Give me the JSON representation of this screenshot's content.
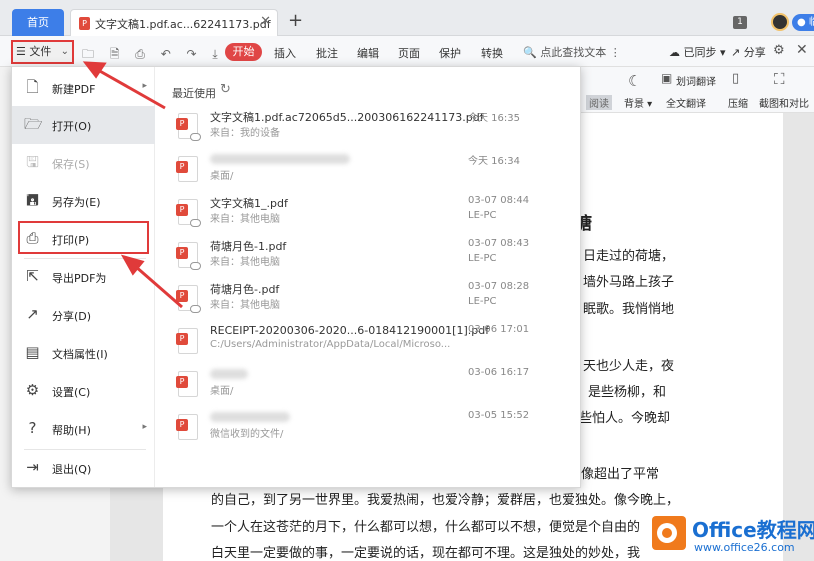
{
  "tabs": {
    "home": "首页",
    "doc_title": "文字文稿1.pdf.ac...62241173.pdf",
    "close": "✕",
    "add": "+"
  },
  "header_right": {
    "badge": "1",
    "pill": "● 临"
  },
  "toolbar": {
    "file_label": "☰ 文件",
    "chevron": "⌄",
    "icons": "🗀 🗎 ⎙ ↶ ↷ ⤓ ▿",
    "start": "开始",
    "items": [
      "插入",
      "批注",
      "编辑",
      "页面",
      "保护",
      "转换"
    ],
    "search": "🔍 点此查找文本 ⋮",
    "sync": "☁ 已同步 ▾",
    "share": "↗ 分享",
    "gear": "⚙",
    "close": "✕"
  },
  "ribbon": {
    "translate": "划词翻译",
    "background": "背景 ▾",
    "full_translate": "全文翻译",
    "compress": "压缩",
    "screenshot": "截图和对比",
    "read_tag": "阅读"
  },
  "menu": {
    "items": [
      {
        "label": "新建PDF",
        "icon": "new-pdf-icon",
        "glyph": "🗋"
      },
      {
        "label": "打开(O)",
        "icon": "open-folder-icon",
        "glyph": "🗁"
      },
      {
        "label": "保存(S)",
        "icon": "save-icon",
        "glyph": "🖫"
      },
      {
        "label": "另存为(E)",
        "icon": "save-as-icon",
        "glyph": "🖪"
      },
      {
        "label": "打印(P)",
        "icon": "printer-icon",
        "glyph": "⎙"
      },
      {
        "label": "导出PDF为",
        "icon": "export-icon",
        "glyph": "⇱"
      },
      {
        "label": "分享(D)",
        "icon": "share-icon",
        "glyph": "↗"
      },
      {
        "label": "文档属性(I)",
        "icon": "properties-icon",
        "glyph": "▤"
      },
      {
        "label": "设置(C)",
        "icon": "settings-icon",
        "glyph": "⚙"
      },
      {
        "label": "帮助(H)",
        "icon": "help-icon",
        "glyph": "?"
      },
      {
        "label": "退出(Q)",
        "icon": "exit-icon",
        "glyph": "⇥"
      }
    ],
    "arrow": "▸",
    "recent_title": "最近使用",
    "refresh": "↻"
  },
  "recent": [
    {
      "name": "文字文稿1.pdf.ac72065d5...200306162241173.pdf",
      "source": "来自：我的设备",
      "time": "今天 16:35",
      "device": ""
    },
    {
      "name": "",
      "source": "桌面/",
      "time": "今天 16:34",
      "device": ""
    },
    {
      "name": "文字文稿1_.pdf",
      "source": "来自：其他电脑",
      "time": "03-07 08:44",
      "device": "LE-PC"
    },
    {
      "name": "荷塘月色-1.pdf",
      "source": "来自：其他电脑",
      "time": "03-07 08:43",
      "device": "LE-PC"
    },
    {
      "name": "荷塘月色-.pdf",
      "source": "来自：其他电脑",
      "time": "03-07 08:28",
      "device": "LE-PC"
    },
    {
      "name": "RECEIPT-20200306-2020...6-018412190001[1].pdf",
      "source": "C:/Users/Administrator/AppData/Local/Microso...",
      "time": "03-06 17:01",
      "device": ""
    },
    {
      "name": "",
      "source": "桌面/",
      "time": "03-06 16:17",
      "device": ""
    },
    {
      "name": "",
      "source": "微信收到的文件/",
      "time": "03-05 15:52",
      "device": ""
    }
  ],
  "document": {
    "heading_char": "塘",
    "lines_right": [
      "日走过的荷塘，",
      "墙外马路上孩子",
      "眠歌。我悄悄地",
      "天也少人走，夜",
      "是些杨柳，和",
      "些怕人。今晚却",
      "也像超出了平常"
    ],
    "lines_full": [
      "的自己，到了另一世界里。我爱热闹，也爱冷静；爱群居，也爱独处。像今晚上，",
      "一个人在这苍茫的月下，什么都可以想，什么都可以不想，便觉是个自由的",
      "白天里一定要做的事，一定要说的话，现在都可不理。这是独处的妙处，我"
    ]
  },
  "watermark": {
    "title": "Office教程网",
    "url": "www.office26.com"
  }
}
